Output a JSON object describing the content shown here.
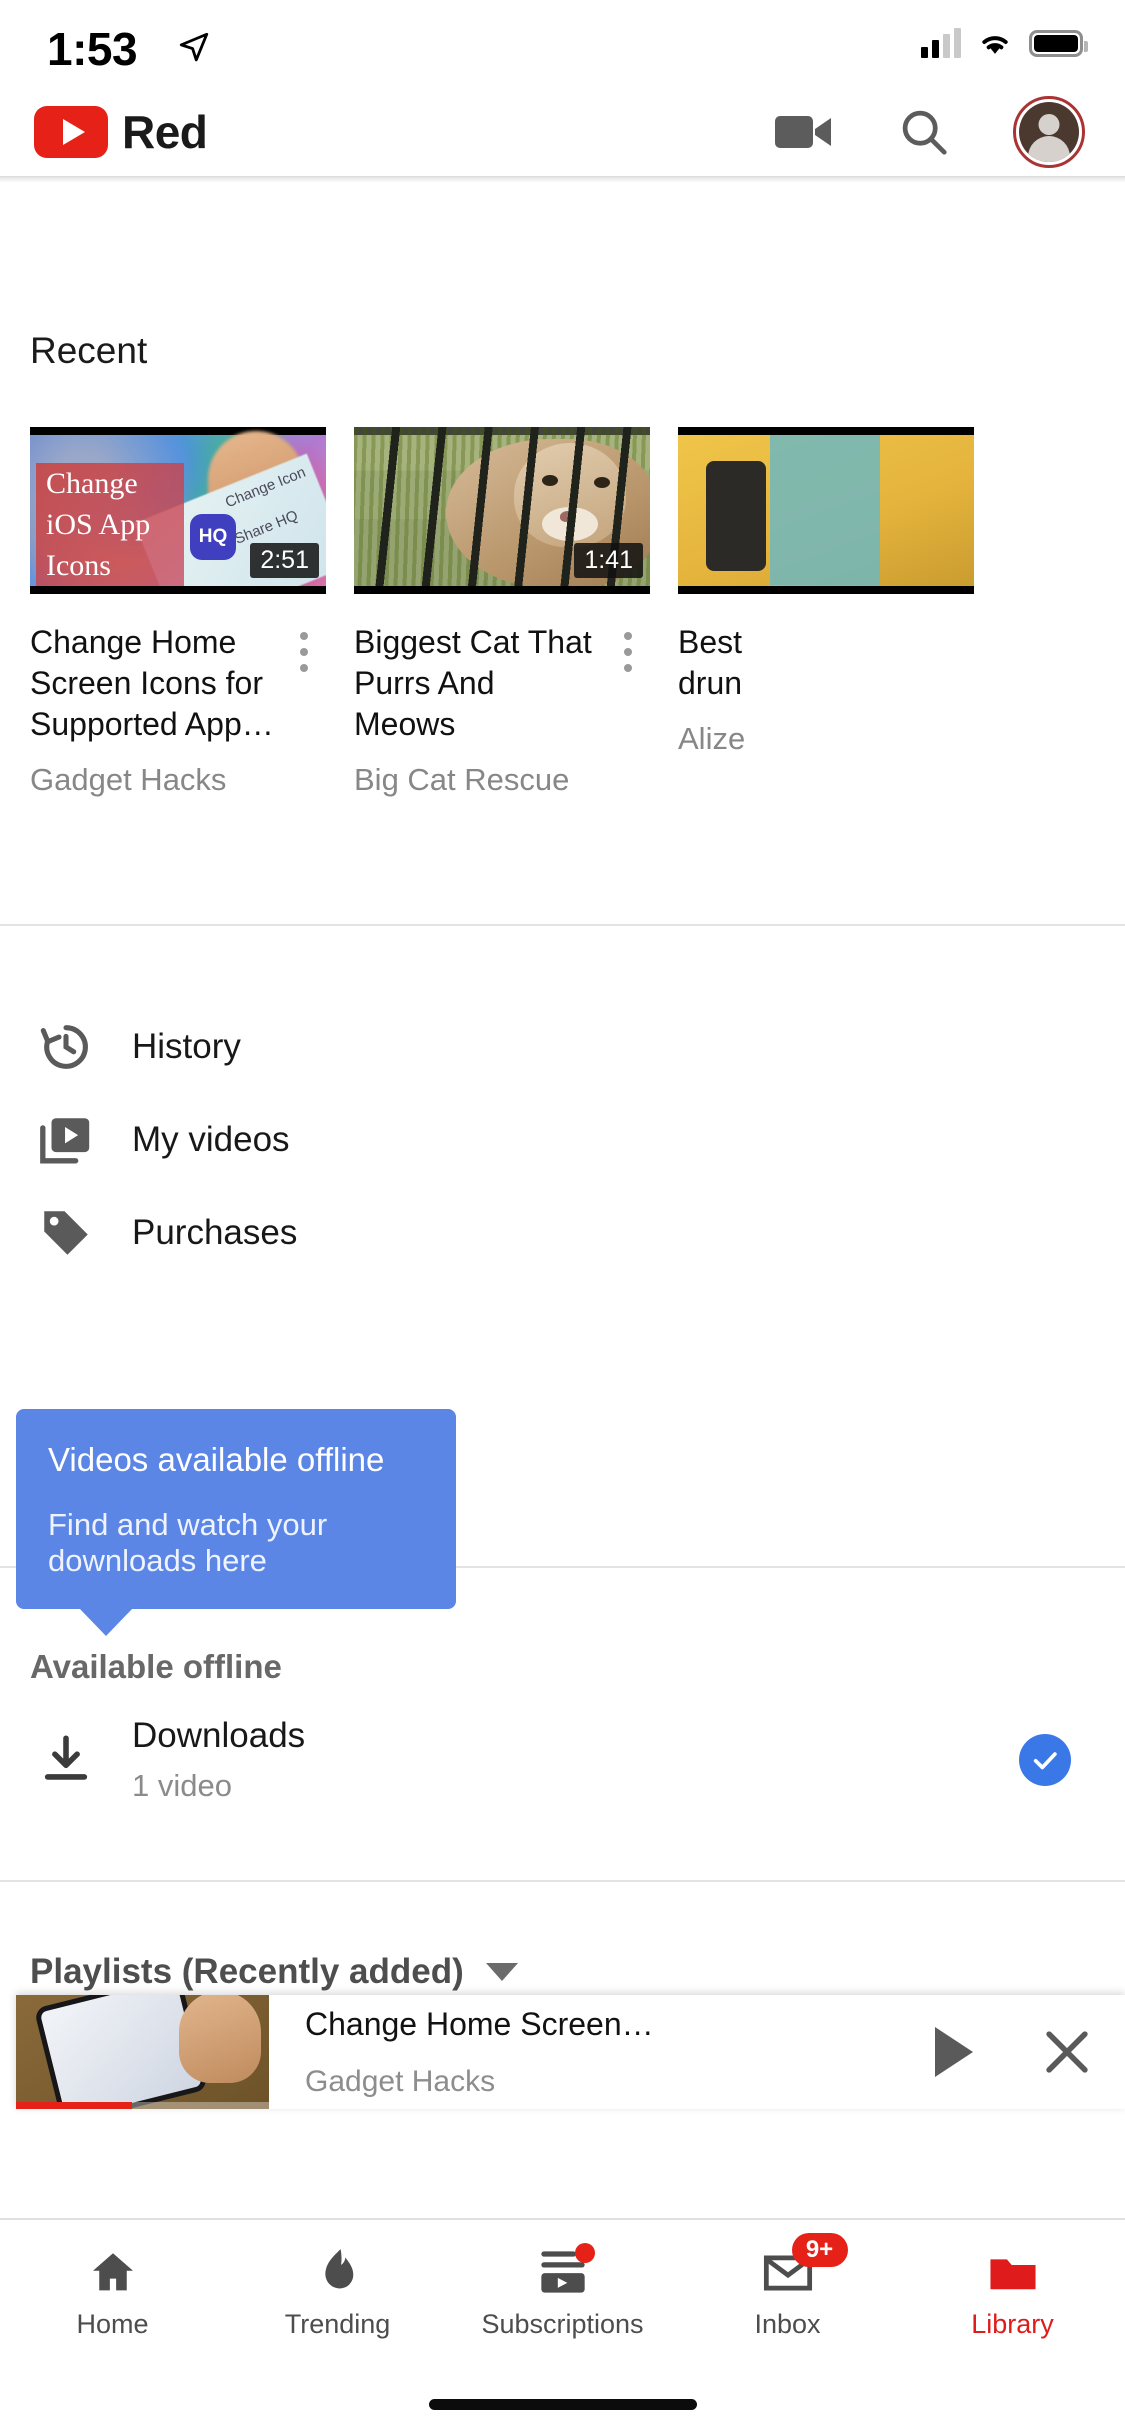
{
  "status_bar": {
    "time": "1:53",
    "location_icon": "location-arrow-icon",
    "signal_icon": "cellular-signal-icon",
    "wifi_icon": "wifi-icon",
    "battery_icon": "battery-icon"
  },
  "header": {
    "brand": "Red",
    "logo_icon": "youtube-logo-icon",
    "logo_color": "#e62117",
    "cast_icon": "video-camera-icon",
    "search_icon": "search-icon",
    "avatar_icon": "account-avatar-icon"
  },
  "recent": {
    "section_title": "Recent",
    "videos": [
      {
        "title": "Change Home Screen Icons for Supported App…",
        "channel": "Gadget Hacks",
        "duration": "2:51",
        "thumb_overlay_lines": [
          "Change",
          "iOS App",
          "Icons"
        ],
        "thumb_labels": [
          "Change Icon",
          "Share HQ"
        ],
        "menu_icon": "kebab-menu-icon"
      },
      {
        "title": "Biggest Cat That Purrs And Meows",
        "channel": "Big Cat Rescue",
        "duration": "1:41",
        "menu_icon": "kebab-menu-icon"
      },
      {
        "title": "Best\ndrun",
        "channel": "Alize",
        "duration": "",
        "menu_icon": "kebab-menu-icon"
      }
    ]
  },
  "library_menu": [
    {
      "label": "History",
      "icon": "history-clock-icon"
    },
    {
      "label": "My videos",
      "icon": "my-videos-icon"
    },
    {
      "label": "Purchases",
      "icon": "price-tag-icon"
    }
  ],
  "tooltip": {
    "title": "Videos available offline",
    "subtitle": "Find and watch your downloads here",
    "background_color": "#5b86e5"
  },
  "offline_section": {
    "label": "Available offline",
    "download_item": {
      "title": "Downloads",
      "subtitle": "1 video",
      "icon": "download-icon",
      "status_icon": "check-circle-icon",
      "status_color": "#3b78e7"
    }
  },
  "playlists": {
    "label": "Playlists (Recently added)",
    "sort_icon": "chevron-down-icon"
  },
  "miniplayer": {
    "title": "Change Home Screen…",
    "channel": "Gadget Hacks",
    "play_icon": "play-icon",
    "close_icon": "close-icon",
    "progress_color": "#e62117"
  },
  "bottom_nav": [
    {
      "label": "Home",
      "icon": "home-icon",
      "active": false,
      "badge": ""
    },
    {
      "label": "Trending",
      "icon": "flame-icon",
      "active": false,
      "badge": ""
    },
    {
      "label": "Subscriptions",
      "icon": "subscriptions-icon",
      "active": false,
      "badge": "dot"
    },
    {
      "label": "Inbox",
      "icon": "inbox-icon",
      "active": false,
      "badge": "9+"
    },
    {
      "label": "Library",
      "icon": "library-folder-icon",
      "active": true,
      "badge": ""
    }
  ],
  "accent_color": "#e62117"
}
